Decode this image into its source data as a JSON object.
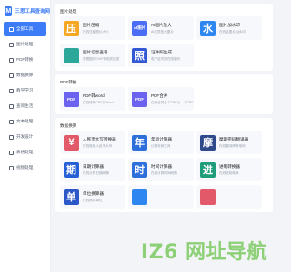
{
  "app": {
    "logo_mark": "M",
    "title": "三思工具查询网"
  },
  "sidebar": {
    "items": [
      {
        "label": "全部工具",
        "active": true,
        "icon": "grid-icon"
      },
      {
        "label": "图片处理",
        "icon": "image-icon"
      },
      {
        "label": "PDF转换",
        "icon": "pdf-icon"
      },
      {
        "label": "数据换算",
        "icon": "calc-icon"
      },
      {
        "label": "教学学习",
        "icon": "book-icon"
      },
      {
        "label": "查询生活",
        "icon": "search-icon"
      },
      {
        "label": "文本处理",
        "icon": "text-icon"
      },
      {
        "label": "开发设计",
        "icon": "code-icon"
      },
      {
        "label": "表格处理",
        "icon": "table-icon"
      },
      {
        "label": "视频处理",
        "icon": "video-icon"
      }
    ]
  },
  "sections": [
    {
      "title": "图片处理",
      "tools": [
        {
          "name": "图片压缩",
          "desc": "在线压缩图片大小",
          "glyph": "压",
          "color": "#f5a623"
        },
        {
          "name": "AI图片放大",
          "desc": "AI无损放大图片",
          "glyph": "AI图片",
          "color": "#4b6cf5"
        },
        {
          "name": "图片加水印",
          "desc": "在线给图片加水印",
          "glyph": "水",
          "color": "#2e86f0"
        },
        {
          "name": "图片信息查看",
          "desc": "查看图片EXIF等相关信息",
          "glyph": "",
          "color": "#2ba89a"
        },
        {
          "name": "证件照生成",
          "desc": "电子证件照在线制作",
          "glyph": "照",
          "color": "#3358d6"
        }
      ]
    },
    {
      "title": "PDF转换",
      "tools": [
        {
          "name": "PDF转word",
          "desc": "在线转换PDF为Word",
          "glyph": "PDF",
          "color": "#6b63f0"
        },
        {
          "name": "PDF合并",
          "desc": "在线合并多个PDF为一个PDF",
          "glyph": "PDF",
          "color": "#6b63f0"
        }
      ]
    },
    {
      "title": "数据换算",
      "tools": [
        {
          "name": "人民币大写转换器",
          "desc": "在线转换人民币大写",
          "glyph": "¥",
          "color": "#e25a6a"
        },
        {
          "name": "年龄计算器",
          "desc": "计算年龄生肖",
          "glyph": "年",
          "color": "#2e6fdc"
        },
        {
          "name": "摩斯密码翻译器",
          "desc": "在线翻译摩斯电码",
          "glyph": "摩",
          "color": "#2f4a8a"
        },
        {
          "name": "日期计算器",
          "desc": "在线计算日期间隔",
          "glyph": "期",
          "color": "#2560d6"
        },
        {
          "name": "时间计算器",
          "desc": "在线计算时间间隔",
          "glyph": "时",
          "color": "#2e6fdc"
        },
        {
          "name": "进制转换器",
          "desc": "在线进制转换",
          "glyph": "进",
          "color": "#1f9c7a"
        },
        {
          "name": "单位换算器",
          "desc": "在线换算单位",
          "glyph": "单",
          "color": "#2b57c9"
        },
        {
          "name": "",
          "desc": "",
          "glyph": "",
          "color": "#2e86f0"
        },
        {
          "name": "",
          "desc": "",
          "glyph": "",
          "color": "#e25a6a"
        }
      ]
    }
  ],
  "watermark": "IZ6 网址导航"
}
